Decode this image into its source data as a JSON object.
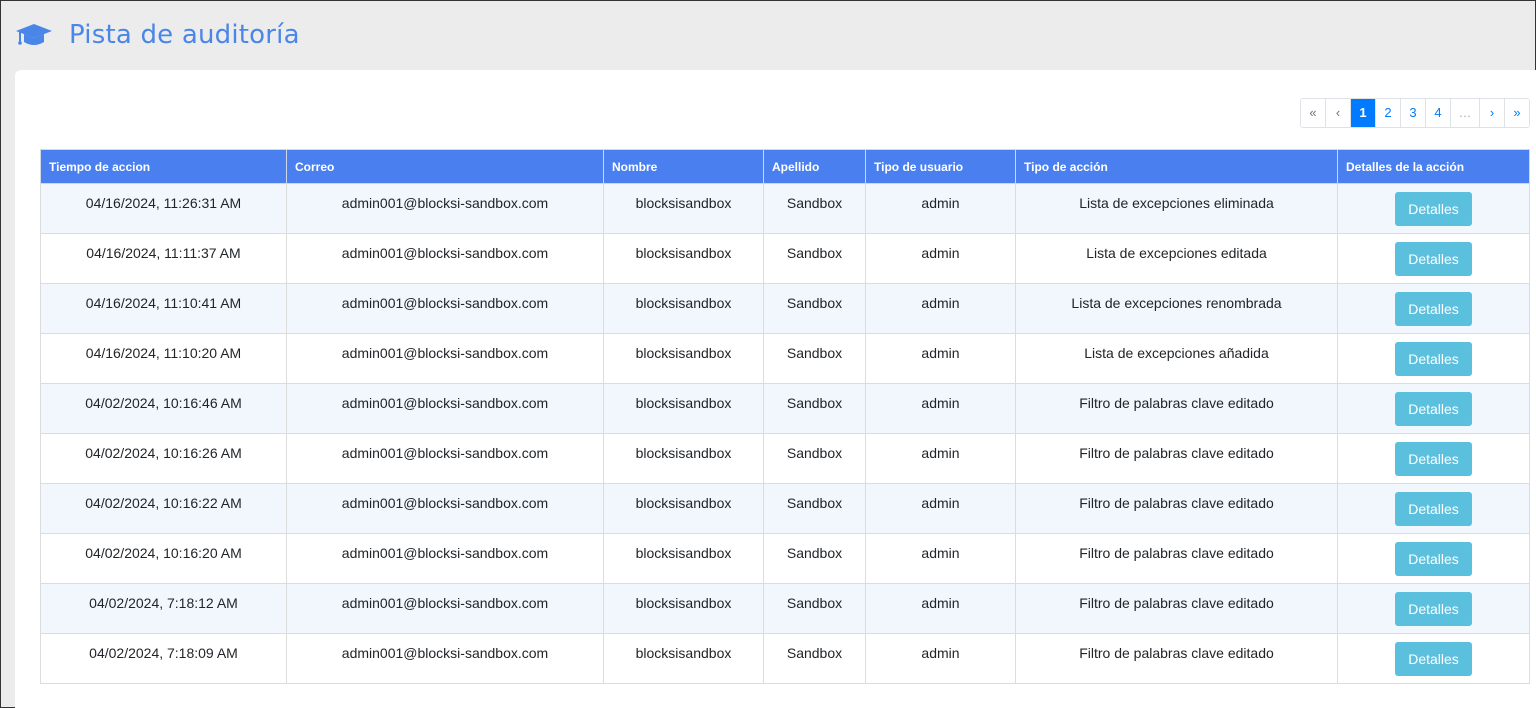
{
  "header": {
    "title": "Pista de auditoría",
    "icon": "graduation-cap-icon",
    "title_color": "#4a86e8"
  },
  "pagination": {
    "first": "«",
    "prev": "‹",
    "pages": [
      "1",
      "2",
      "3",
      "4"
    ],
    "active": "1",
    "ellipsis": "…",
    "next": "›",
    "last": "»"
  },
  "table": {
    "columns": [
      "Tiempo de accion",
      "Correo",
      "Nombre",
      "Apellido",
      "Tipo de usuario",
      "Tipo de acción",
      "Detalles de la acción"
    ],
    "button_label": "Detalles",
    "header_color": "#4a7ff0",
    "button_color": "#5bc0de",
    "rows": [
      {
        "time": "04/16/2024, 11:26:31 AM",
        "email": "admin001@blocksi-sandbox.com",
        "first_name": "blocksisandbox",
        "last_name": "Sandbox",
        "user_type": "admin",
        "action": "Lista de excepciones eliminada"
      },
      {
        "time": "04/16/2024, 11:11:37 AM",
        "email": "admin001@blocksi-sandbox.com",
        "first_name": "blocksisandbox",
        "last_name": "Sandbox",
        "user_type": "admin",
        "action": "Lista de excepciones editada"
      },
      {
        "time": "04/16/2024, 11:10:41 AM",
        "email": "admin001@blocksi-sandbox.com",
        "first_name": "blocksisandbox",
        "last_name": "Sandbox",
        "user_type": "admin",
        "action": "Lista de excepciones renombrada"
      },
      {
        "time": "04/16/2024, 11:10:20 AM",
        "email": "admin001@blocksi-sandbox.com",
        "first_name": "blocksisandbox",
        "last_name": "Sandbox",
        "user_type": "admin",
        "action": "Lista de excepciones añadida"
      },
      {
        "time": "04/02/2024, 10:16:46 AM",
        "email": "admin001@blocksi-sandbox.com",
        "first_name": "blocksisandbox",
        "last_name": "Sandbox",
        "user_type": "admin",
        "action": "Filtro de palabras clave editado"
      },
      {
        "time": "04/02/2024, 10:16:26 AM",
        "email": "admin001@blocksi-sandbox.com",
        "first_name": "blocksisandbox",
        "last_name": "Sandbox",
        "user_type": "admin",
        "action": "Filtro de palabras clave editado"
      },
      {
        "time": "04/02/2024, 10:16:22 AM",
        "email": "admin001@blocksi-sandbox.com",
        "first_name": "blocksisandbox",
        "last_name": "Sandbox",
        "user_type": "admin",
        "action": "Filtro de palabras clave editado"
      },
      {
        "time": "04/02/2024, 10:16:20 AM",
        "email": "admin001@blocksi-sandbox.com",
        "first_name": "blocksisandbox",
        "last_name": "Sandbox",
        "user_type": "admin",
        "action": "Filtro de palabras clave editado"
      },
      {
        "time": "04/02/2024, 7:18:12 AM",
        "email": "admin001@blocksi-sandbox.com",
        "first_name": "blocksisandbox",
        "last_name": "Sandbox",
        "user_type": "admin",
        "action": "Filtro de palabras clave editado"
      },
      {
        "time": "04/02/2024, 7:18:09 AM",
        "email": "admin001@blocksi-sandbox.com",
        "first_name": "blocksisandbox",
        "last_name": "Sandbox",
        "user_type": "admin",
        "action": "Filtro de palabras clave editado"
      }
    ]
  }
}
